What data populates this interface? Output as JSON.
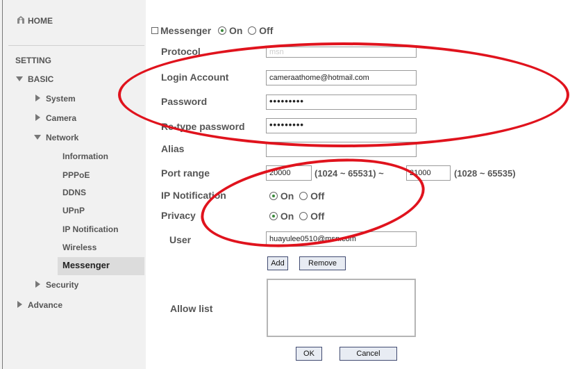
{
  "sidebar": {
    "home_label": "HOME",
    "setting_label": "SETTING",
    "basic_label": "BASIC",
    "system_label": "System",
    "camera_label": "Camera",
    "network_label": "Network",
    "network_items": [
      "Information",
      "PPPoE",
      "DDNS",
      "UPnP",
      "IP Notification",
      "Wireless",
      "Messenger"
    ],
    "security_label": "Security",
    "advance_label": "Advance",
    "active_item": "Messenger"
  },
  "form": {
    "messenger_label": "Messenger",
    "on_label": "On",
    "off_label": "Off",
    "protocol_label": "Protocol",
    "protocol_value": "msn",
    "login_label": "Login Account",
    "login_value": "cameraathome@hotmail.com",
    "password_label": "Password",
    "password_value": "•••••••••",
    "retype_label": "Re-type password",
    "retype_value": "•••••••••",
    "alias_label": "Alias",
    "alias_value": "",
    "port_label": "Port range",
    "port_from": "20000",
    "port_from_hint": "(1024 ~ 65531) ~",
    "port_to": "21000",
    "port_to_hint": "(1028 ~ 65535)",
    "ipnotify_label": "IP Notification",
    "privacy_label": "Privacy",
    "user_label": "User",
    "user_value": "huayulee0510@msn.com",
    "add_label": "Add",
    "remove_label": "Remove",
    "allow_label": "Allow list",
    "ok_label": "OK",
    "cancel_label": "Cancel"
  },
  "colors": {
    "annotation": "#e0131d",
    "sidebar_bg": "#f1f1f1",
    "active_bg": "#dcdcdc"
  }
}
